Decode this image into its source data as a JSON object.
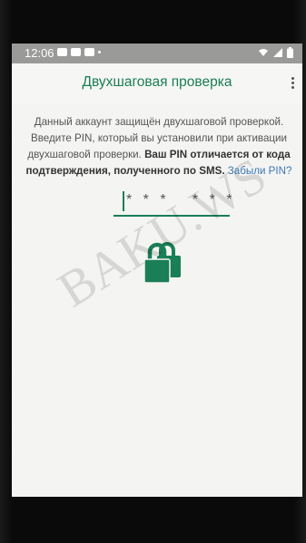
{
  "status_bar": {
    "time": "12:06"
  },
  "app_bar": {
    "title": "Двухшаговая проверка",
    "menu_icon": "more-vert-icon"
  },
  "description": {
    "text_1": "Данный аккаунт защищён двухшаговой проверкой. Введите PIN, который вы установили при активации двухшаговой проверки. ",
    "text_bold": "Ваш PIN отличается от кода подтверждения, полученного по SMS.",
    "link": "Забыли PIN?"
  },
  "pin_input": {
    "value": "* * *   * * *"
  },
  "lock_icon": "locks-icon",
  "colors": {
    "accent": "#1a7e57",
    "link": "#3d78b6",
    "status_bar": "#9a9a98"
  },
  "watermark": "BAKU.WS"
}
